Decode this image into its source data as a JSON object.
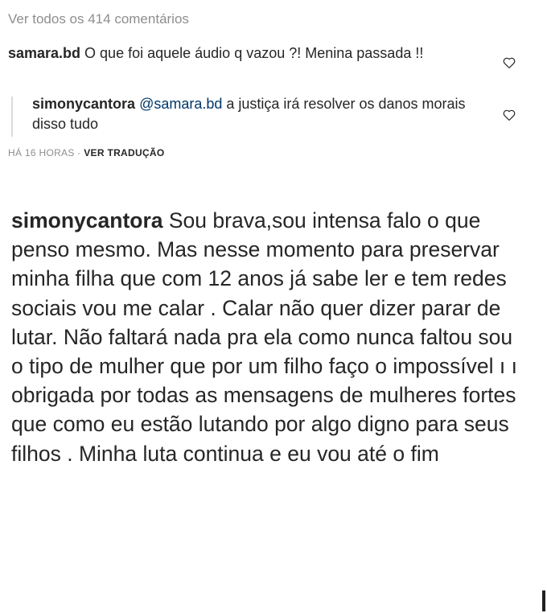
{
  "comments": {
    "view_all": "Ver todos os 414 comentários",
    "comment1": {
      "username": "samara.bd",
      "text": " O que foi aquele áudio q vazou ?! Menina passada !!"
    },
    "reply": {
      "username": "simonycantora",
      "mention": "@samara.bd",
      "text": " a justiça irá resolver os danos morais disso tudo"
    },
    "meta": {
      "time": "HÁ 16 HORAS",
      "separator": " · ",
      "translate": "VER TRADUÇÃO"
    },
    "icons": {
      "like": "heart-outline-icon"
    }
  },
  "caption": {
    "username": "simonycantora",
    "text": " Sou brava,sou intensa falo o que penso mesmo. Mas nesse momento para preservar minha filha que com 12 anos já sabe ler e tem redes sociais vou me calar . Calar não quer dizer parar de lutar. Não faltará nada pra ela como nunca faltou sou o tipo de mulher que por um filho faço o impossível ı ı  obrigada por todas as mensagens de mulheres fortes que como eu estão lutando por algo digno para seus filhos . Minha luta continua e eu vou até o fim"
  },
  "colors": {
    "text": "#262626",
    "secondary": "#8e8e8e",
    "link": "#00376b"
  }
}
